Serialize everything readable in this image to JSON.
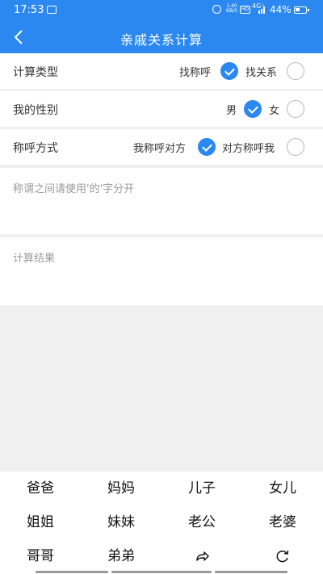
{
  "status_bar": {
    "time": "17:53",
    "net_speed_value": "1.40",
    "net_speed_unit": "KB/S",
    "hd": "HD",
    "signal": "4G⁺",
    "battery_text": "44%",
    "battery_level": 0.44
  },
  "header": {
    "title": "亲戚关系计算",
    "back_icon": "chevron-left-icon"
  },
  "rows": {
    "calc_type": {
      "label": "计算类型",
      "option1": "找称呼",
      "option2": "找关系",
      "selected": 1
    },
    "gender": {
      "label": "我的性别",
      "option1": "男",
      "option2": "女",
      "selected": 1
    },
    "address": {
      "label": "称呼方式",
      "option1": "我称呼对方",
      "option2": "对方称呼我",
      "selected": 1
    }
  },
  "input": {
    "placeholder": "称谓之间请使用'的'字分开"
  },
  "result": {
    "placeholder": "计算结果"
  },
  "keyboard": {
    "keys": [
      "爸爸",
      "妈妈",
      "儿子",
      "女儿",
      "姐姐",
      "妹妹",
      "老公",
      "老婆",
      "哥哥",
      "弟弟"
    ],
    "share_icon": "share-arrow-icon",
    "reset_icon": "refresh-icon"
  },
  "colors": {
    "accent": "#2b88f0",
    "background": "#f0f0f0",
    "placeholder": "#9a9a9a"
  }
}
